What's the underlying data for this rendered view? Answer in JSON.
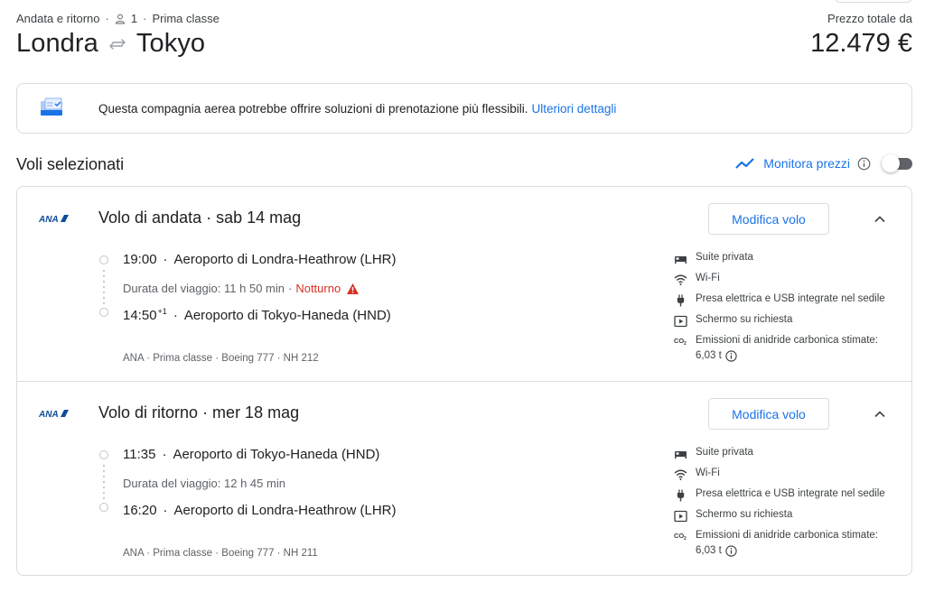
{
  "header": {
    "trip_type": "Andata e ritorno",
    "passengers": "1",
    "cabin_class": "Prima classe",
    "origin": "Londra",
    "destination": "Tokyo",
    "price_label": "Prezzo totale da",
    "price_value": "12.479 €"
  },
  "notice": {
    "text": "Questa compagnia aerea potrebbe offrire soluzioni di prenotazione più flessibili.",
    "link": "Ulteriori dettagli"
  },
  "selected": {
    "title": "Voli selezionati",
    "monitor_label": "Monitora prezzi",
    "monitor_enabled": false
  },
  "colors": {
    "accent": "#1a73e8",
    "warning": "#d93025",
    "border": "#dadce0"
  },
  "flights": [
    {
      "airline": "ANA",
      "heading": "Volo di andata · sab 14 mag",
      "edit_label": "Modifica volo",
      "departure_time": "19:00",
      "departure_airport": "Aeroporto di Londra-Heathrow (LHR)",
      "duration": "Durata del viaggio: 11 h 50 min",
      "overnight_label": "Notturno",
      "arrival_time": "14:50",
      "arrival_day_offset": "+1",
      "arrival_airport": "Aeroporto di Tokyo-Haneda (HND)",
      "details": "ANA · Prima classe · Boeing 777 · NH 212",
      "amenities": {
        "suite": "Suite privata",
        "wifi": "Wi-Fi",
        "power": "Presa elettrica e USB integrate nel sedile",
        "screen": "Schermo su richiesta",
        "co2_label": "Emissioni di anidride carbonica stimate:",
        "co2_value": "6,03 t"
      }
    },
    {
      "airline": "ANA",
      "heading": "Volo di ritorno · mer 18 mag",
      "edit_label": "Modifica volo",
      "departure_time": "11:35",
      "departure_airport": "Aeroporto di Tokyo-Haneda (HND)",
      "duration": "Durata del viaggio: 12 h 45 min",
      "arrival_time": "16:20",
      "arrival_airport": "Aeroporto di Londra-Heathrow (LHR)",
      "details": "ANA · Prima classe · Boeing 777 · NH 211",
      "amenities": {
        "suite": "Suite privata",
        "wifi": "Wi-Fi",
        "power": "Presa elettrica e USB integrate nel sedile",
        "screen": "Schermo su richiesta",
        "co2_label": "Emissioni di anidride carbonica stimate:",
        "co2_value": "6,03 t"
      }
    }
  ]
}
